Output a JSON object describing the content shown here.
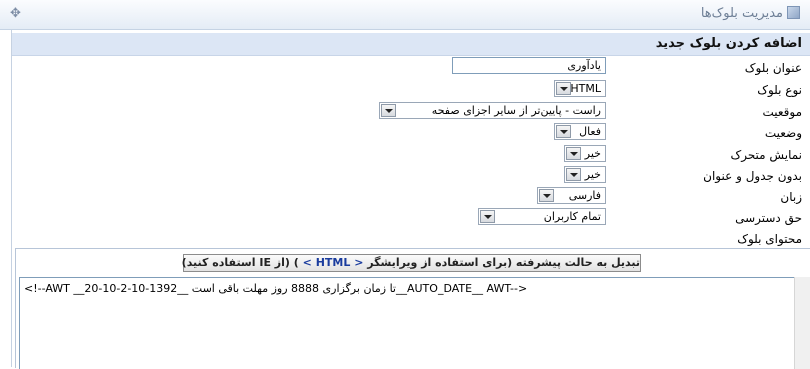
{
  "window": {
    "title": "مدیریت بلوک‌ها",
    "move_glyph": "✥"
  },
  "form": {
    "header": "اضافه کردن بلوک جدید",
    "fields": [
      {
        "label": "عنوان بلوک",
        "value": "یادآوری"
      },
      {
        "label": "نوع بلوک",
        "value": "HTML"
      },
      {
        "label": "موقعیت",
        "value": "راست - پایین‌تر از سایر اجزای صفحه"
      },
      {
        "label": "وضعیت",
        "value": "فعال"
      },
      {
        "label": "نمایش متحرک",
        "value": "خیر"
      },
      {
        "label": "بدون جدول و عنوان",
        "value": "خیر"
      },
      {
        "label": "زبان",
        "value": "فارسی"
      },
      {
        "label": "حق دسترسی",
        "value": "تمام کاربران"
      },
      {
        "label": "محتوای بلوک"
      }
    ]
  },
  "editor": {
    "toggle_button": {
      "part1": "تبدیل به حالت پیشرفته   (برای استفاده از ویرایشگر",
      "html": "< HTML >",
      "part2": ")   (از IE استفاده کنید)"
    },
    "content": "<!--AWT __تا زمان برگزاری 8888 روز مهلت باقی است __1392-10-2-10-20__AUTO_DATE__ AWT-->"
  },
  "icons": {
    "title_icon": "blocks-icon",
    "move_icon": "move-icon",
    "dropdown_icon": "chevron-down-icon"
  }
}
